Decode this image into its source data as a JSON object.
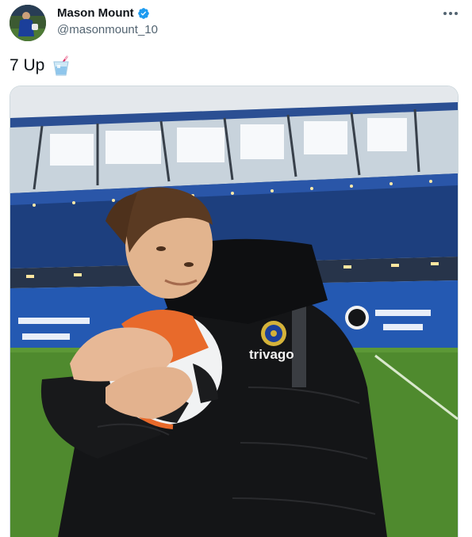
{
  "author": {
    "display_name": "Mason Mount",
    "handle": "@masonmount_10",
    "verified": true,
    "verified_icon": "verified-badge-icon",
    "avatar_icon": "profile-avatar"
  },
  "tweet": {
    "text": "7 Up",
    "emoji_icon": "tumbler-glass-with-straw-icon"
  },
  "menu": {
    "icon": "more-horizontal-icon"
  },
  "media": {
    "description_icon": "photo-player-hugging-football-in-stadium",
    "jersey_text": "trivago"
  },
  "colors": {
    "verified_blue": "#1d9bf0",
    "handle_gray": "#536471",
    "border": "#cfd9de",
    "pitch_green": "#4f8a2e",
    "seats_blue": "#1f4f98"
  }
}
